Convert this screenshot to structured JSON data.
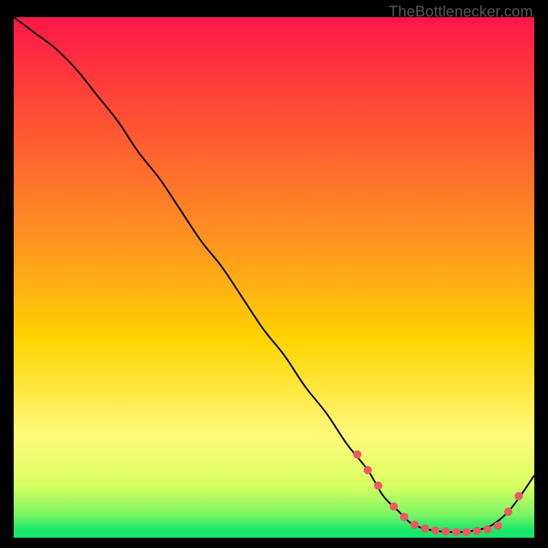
{
  "watermark": "TheBottlenecker.com",
  "colors": {
    "top": "#ff1747",
    "mid": "#ffd400",
    "bottom_green": "#17e86b",
    "curve": "#000000",
    "marker": "#ef5860",
    "frame_bg": "#000000"
  },
  "chart_data": {
    "type": "line",
    "title": "",
    "xlabel": "",
    "ylabel": "",
    "xlim": [
      0,
      100
    ],
    "ylim": [
      0,
      100
    ],
    "grid": false,
    "legend": false,
    "series": [
      {
        "name": "curve",
        "x": [
          0,
          4,
          8,
          12,
          16,
          20,
          24,
          28,
          32,
          36,
          40,
          44,
          48,
          52,
          56,
          60,
          64,
          68,
          71,
          74,
          76,
          78,
          80,
          82,
          84,
          86,
          88,
          90,
          92,
          95,
          98,
          100
        ],
        "y": [
          100,
          97,
          94,
          90,
          85,
          80,
          74,
          69,
          63,
          57,
          52,
          46,
          40,
          35,
          29,
          24,
          18,
          13,
          8,
          5,
          3,
          2,
          1.5,
          1.2,
          1.1,
          1.1,
          1.3,
          1.7,
          2.5,
          5,
          9,
          12
        ]
      }
    ],
    "markers": {
      "name": "dots",
      "x": [
        66,
        68,
        70,
        73,
        75,
        77,
        79,
        81,
        83,
        85,
        87,
        89,
        91,
        93,
        95,
        97
      ],
      "y": [
        16,
        13,
        10,
        6,
        4,
        2.5,
        1.8,
        1.4,
        1.2,
        1.1,
        1.1,
        1.3,
        1.6,
        2.3,
        5,
        8
      ]
    },
    "gradient_stops": [
      {
        "pos": 0.0,
        "color": "#ff1747"
      },
      {
        "pos": 0.45,
        "color": "#ff9a1e"
      },
      {
        "pos": 0.62,
        "color": "#ffd400"
      },
      {
        "pos": 0.8,
        "color": "#fff97a"
      },
      {
        "pos": 0.9,
        "color": "#d9ff60"
      },
      {
        "pos": 0.955,
        "color": "#7cf463"
      },
      {
        "pos": 0.985,
        "color": "#17e86b"
      },
      {
        "pos": 1.0,
        "color": "#17e86b"
      }
    ]
  }
}
